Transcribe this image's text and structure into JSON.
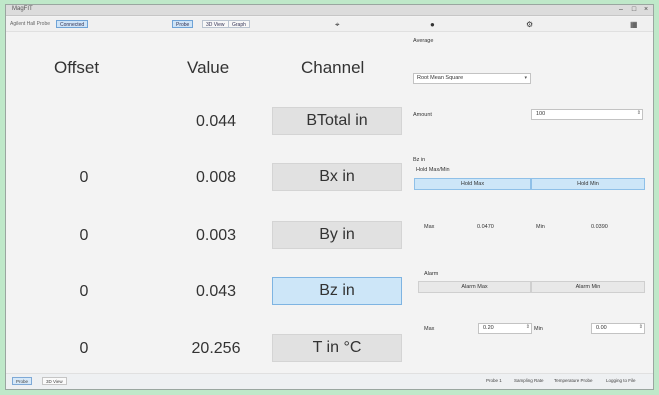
{
  "window": {
    "title": "MagFIT"
  },
  "toolbar": {
    "left_text": "Agilent Hall Probe",
    "connection_badge": "Connected",
    "tabs": [
      "Probe",
      "3D View",
      "Graph"
    ],
    "icons": [
      "pin-icon",
      "record-icon",
      "settings-icon",
      "grid-icon"
    ]
  },
  "table": {
    "headers": {
      "offset": "Offset",
      "value": "Value",
      "channel": "Channel"
    },
    "rows": [
      {
        "offset": "",
        "value": "0.044",
        "channel": "BTotal in",
        "selected": false
      },
      {
        "offset": "0",
        "value": "0.008",
        "channel": "Bx in",
        "selected": false
      },
      {
        "offset": "0",
        "value": "0.003",
        "channel": "By in",
        "selected": false
      },
      {
        "offset": "0",
        "value": "0.043",
        "channel": "Bz in",
        "selected": true
      },
      {
        "offset": "0",
        "value": "20.256",
        "channel": "T in °C",
        "selected": false
      }
    ]
  },
  "right_panel": {
    "average_label": "Average",
    "average_mode": "Root Mean Square",
    "amount_label": "Amount",
    "amount_value": "100",
    "channel_label": "Bz in",
    "holdmax_label": "Hold Max/Min",
    "hold_max_button": "Hold Max",
    "hold_min_button": "Hold Min",
    "max_label": "Max",
    "max_value": "0.0470",
    "min_label": "Min",
    "min_value": "0.0390",
    "alarm_label": "Alarm",
    "alarm_max_button": "Alarm Max",
    "alarm_min_button": "Alarm Min",
    "alarm_max_label": "Max",
    "alarm_max_value": "0.20",
    "alarm_min_label": "Min",
    "alarm_min_value": "0.00"
  },
  "statusbar": {
    "tabs": [
      "Probe",
      "3D View"
    ],
    "items": [
      "Probe 1",
      "Sampling Rate",
      "Temperature Probe",
      "Logging to File"
    ]
  },
  "colors": {
    "accent": "#cde6f8",
    "background": "#f3f3f3",
    "outer": "#bfe8c9"
  }
}
